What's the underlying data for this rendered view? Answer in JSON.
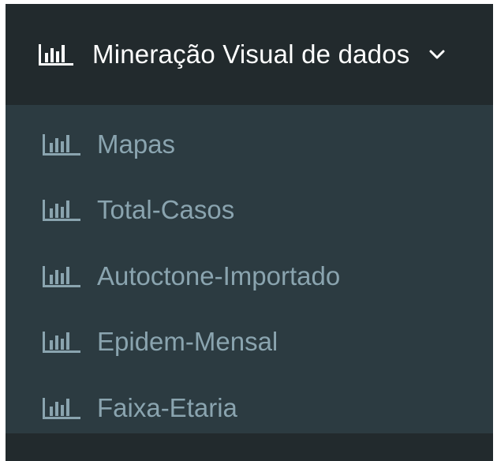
{
  "menu": {
    "title": "Mineração Visual de dados",
    "title_icon": "bar-chart-icon",
    "expand_icon": "chevron-down-icon",
    "items": [
      {
        "label": "Mapas",
        "icon": "bar-chart-icon"
      },
      {
        "label": "Total-Casos",
        "icon": "bar-chart-icon"
      },
      {
        "label": "Autoctone-Importado",
        "icon": "bar-chart-icon"
      },
      {
        "label": "Epidem-Mensal",
        "icon": "bar-chart-icon"
      },
      {
        "label": "Faixa-Etaria",
        "icon": "bar-chart-icon"
      }
    ]
  },
  "colors": {
    "header_bg": "#222a2d",
    "submenu_bg": "#2c3b41",
    "header_text": "#ffffff",
    "item_text": "#8aa4af"
  }
}
